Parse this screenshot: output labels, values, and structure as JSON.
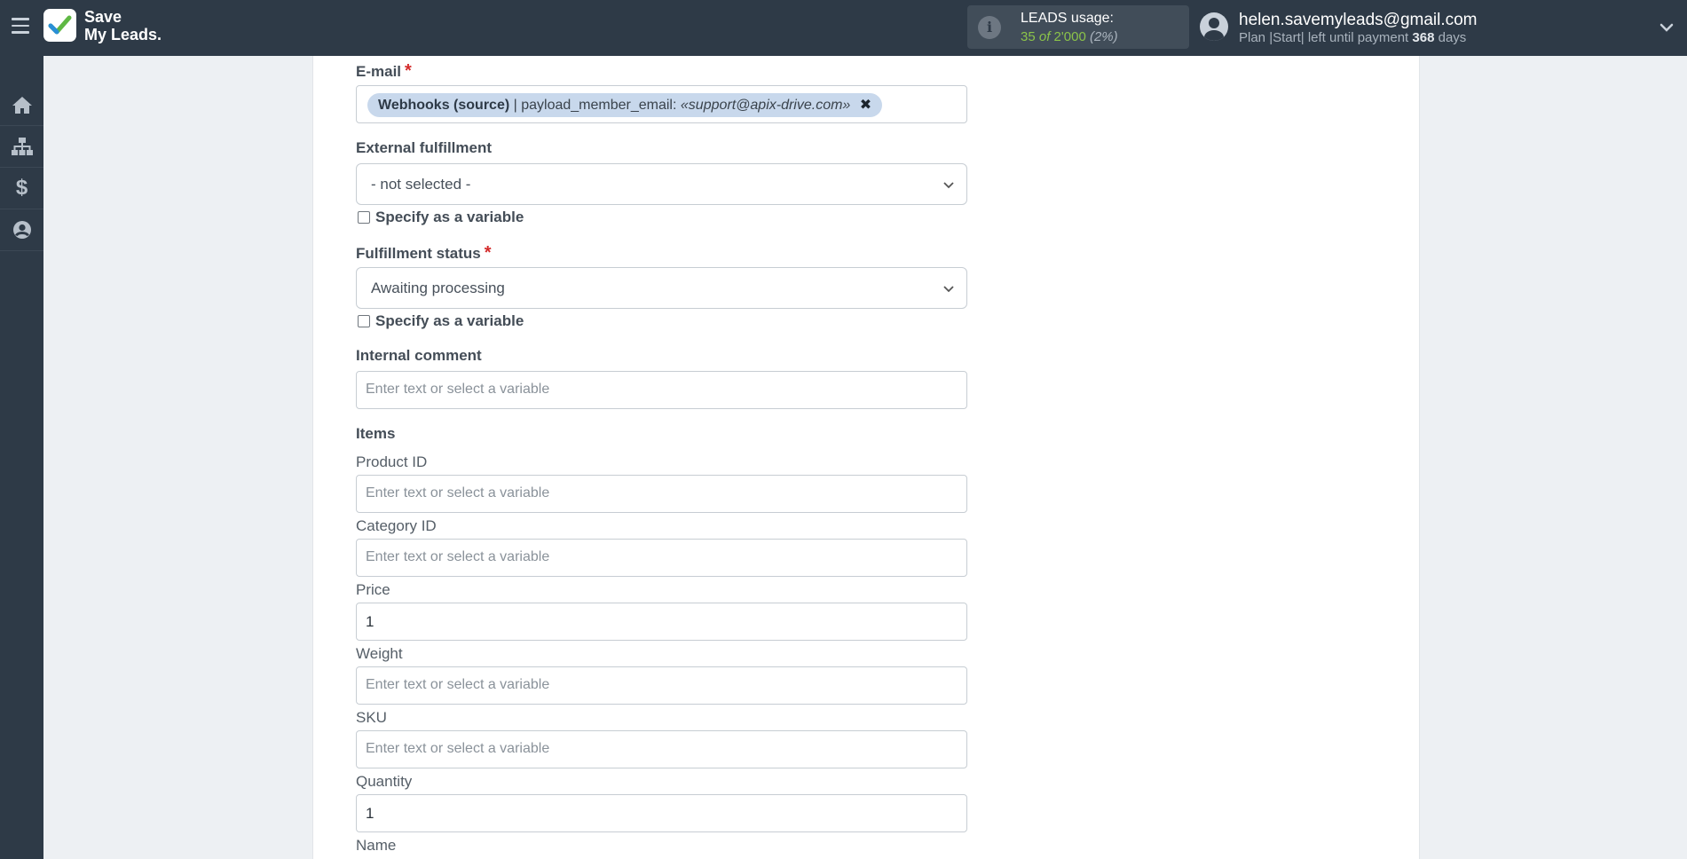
{
  "header": {
    "brand_line1": "Save",
    "brand_line2": "My Leads.",
    "usage_label": "LEADS usage:",
    "usage_used": "35",
    "usage_of": "of",
    "usage_total": "2'000",
    "usage_percent": "(2%)",
    "user_email": "helen.savemyleads@gmail.com",
    "plan_text": "Plan |Start| left until payment",
    "days_count": "368",
    "days_word": "days"
  },
  "sidebar": {
    "items": [
      {
        "icon": "home-icon"
      },
      {
        "icon": "sitemap-icon"
      },
      {
        "icon": "dollar-icon"
      },
      {
        "icon": "user-circle-icon"
      }
    ]
  },
  "form": {
    "email": {
      "label": "E-mail",
      "required_mark": "*",
      "tag_source": "Webhooks (source)",
      "tag_sep": "| payload_member_email:",
      "tag_value": "«support@apix-drive.com»",
      "tag_remove": "✖"
    },
    "external_fulfillment": {
      "label": "External fulfillment",
      "selected": "- not selected -",
      "checkbox_label": "Specify as a variable"
    },
    "fulfillment_status": {
      "label": "Fulfillment status",
      "required_mark": "*",
      "selected": "Awaiting processing",
      "checkbox_label": "Specify as a variable"
    },
    "internal_comment": {
      "label": "Internal comment",
      "placeholder": "Enter text or select a variable"
    },
    "items_heading": "Items",
    "product_id": {
      "label": "Product ID",
      "placeholder": "Enter text or select a variable"
    },
    "category_id": {
      "label": "Category ID",
      "placeholder": "Enter text or select a variable"
    },
    "price": {
      "label": "Price",
      "value": "1"
    },
    "weight": {
      "label": "Weight",
      "placeholder": "Enter text or select a variable"
    },
    "sku": {
      "label": "SKU",
      "placeholder": "Enter text or select a variable"
    },
    "quantity": {
      "label": "Quantity",
      "value": "1"
    },
    "name": {
      "label": "Name"
    }
  },
  "colors": {
    "topbar": "#2e3a47",
    "accent_green": "#8bc34a",
    "tag_bg": "#c8d8ec",
    "required": "#d42b2b"
  }
}
